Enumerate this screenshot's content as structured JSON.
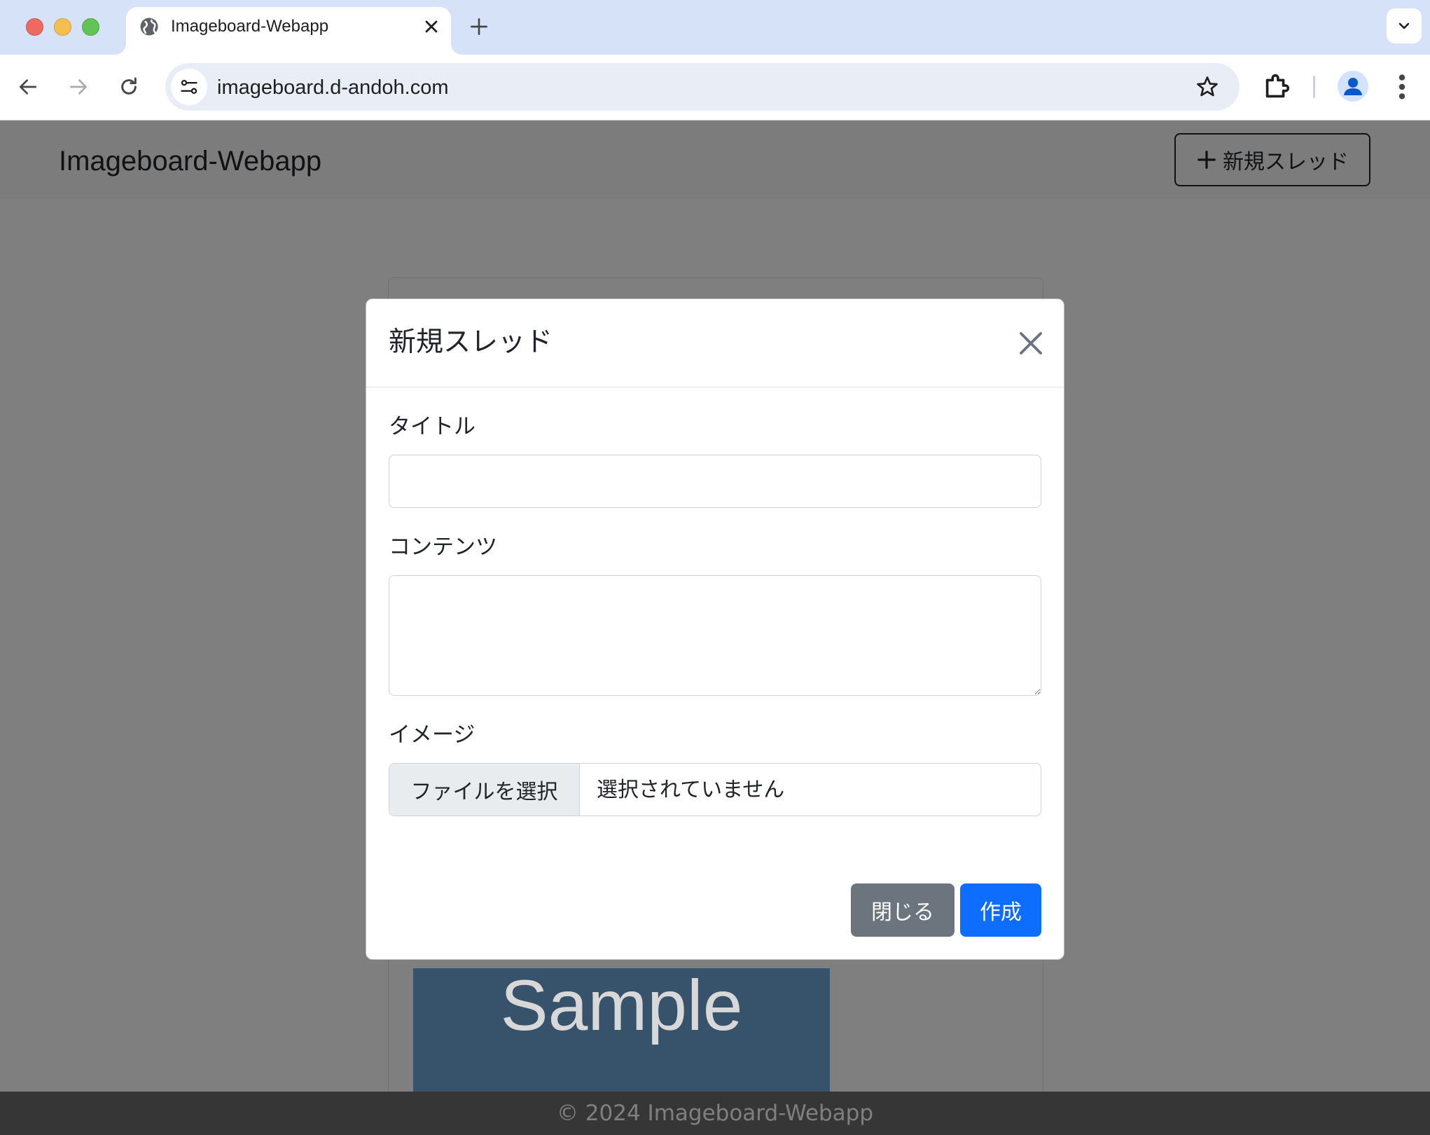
{
  "browser": {
    "tab_title": "Imageboard-Webapp",
    "url": "imageboard.d-andoh.com"
  },
  "navbar": {
    "brand": "Imageboard-Webapp",
    "new_thread_label": "新規スレッド"
  },
  "card": {
    "image_text": "Sample"
  },
  "footer": {
    "text": "© 2024 Imageboard-Webapp"
  },
  "modal": {
    "title": "新規スレッド",
    "title_label": "タイトル",
    "title_value": "",
    "content_label": "コンテンツ",
    "content_value": "",
    "image_label": "イメージ",
    "file_button_label": "ファイルを選択",
    "file_status": "選択されていません",
    "close_label": "閉じる",
    "create_label": "作成"
  },
  "colors": {
    "primary": "#0d6efd",
    "secondary": "#6c757d",
    "tabstrip": "#d6e2f8"
  }
}
